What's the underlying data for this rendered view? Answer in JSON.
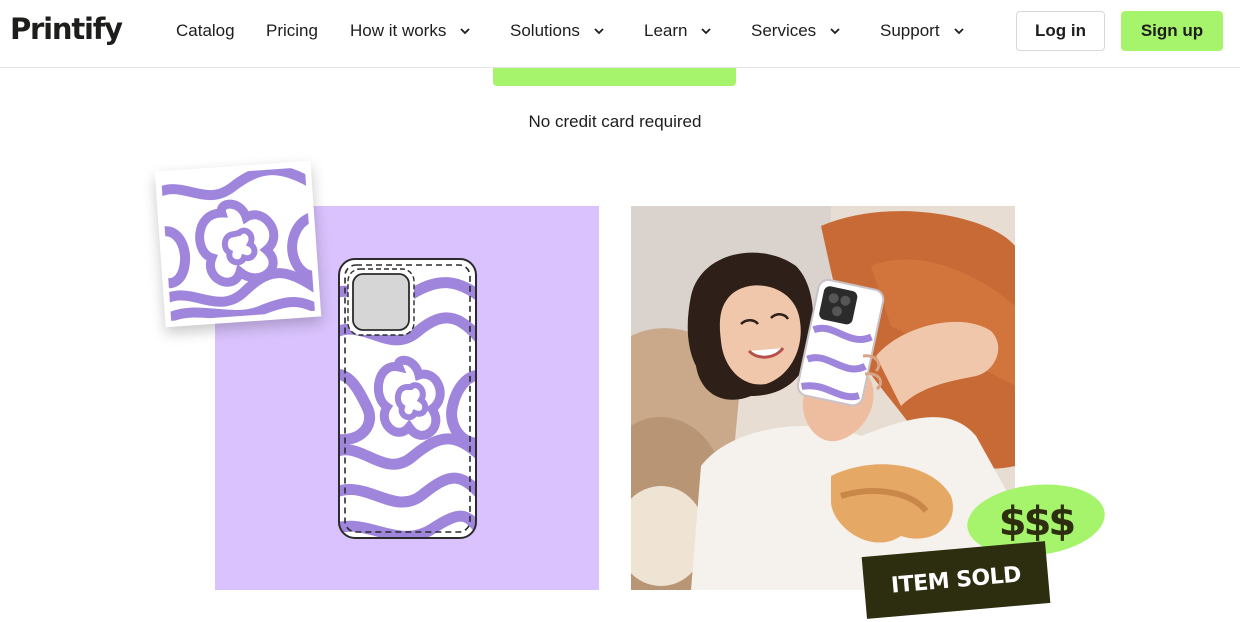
{
  "brand": {
    "logo": "Printify",
    "accent": "#a6f36c",
    "lilac": "#d9c2fd",
    "wave_purple": "#9f86dc",
    "dark": "#2d2d10"
  },
  "nav": {
    "items": [
      {
        "label": "Catalog",
        "has_dropdown": false
      },
      {
        "label": "Pricing",
        "has_dropdown": false
      },
      {
        "label": "How it works",
        "has_dropdown": true
      },
      {
        "label": "Solutions",
        "has_dropdown": true
      },
      {
        "label": "Learn",
        "has_dropdown": true
      },
      {
        "label": "Services",
        "has_dropdown": true
      },
      {
        "label": "Support",
        "has_dropdown": true
      }
    ],
    "login_label": "Log in",
    "signup_label": "Sign up"
  },
  "hero": {
    "no_credit_card": "No credit card required"
  },
  "badges": {
    "money": "$$$",
    "item_sold": "ITEM SOLD"
  }
}
